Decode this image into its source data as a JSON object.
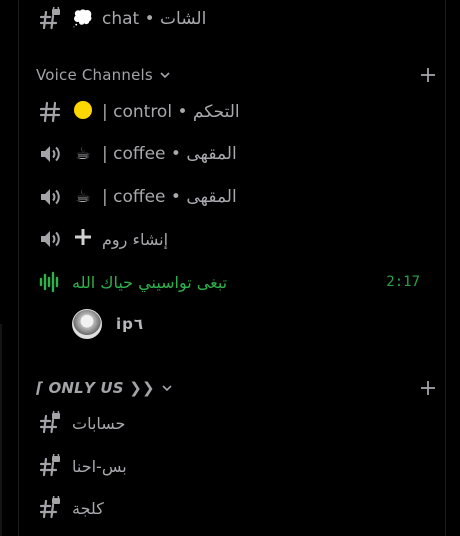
{
  "channels_top": [
    {
      "name": "chat • الشات",
      "emoji": "💭",
      "icon": "hash-locked-icon"
    }
  ],
  "categories": [
    {
      "name": "Voice Channels",
      "add_icon": "plus-icon"
    },
    {
      "name": "⌈ 𝙊𝙉𝙇𝙔 𝙐𝙎 ❯❯",
      "add_icon": "plus-icon"
    }
  ],
  "voice_section": [
    {
      "name": "| control • التحكم",
      "emoji": "🟡",
      "icon": "hash-icon"
    },
    {
      "name": "| coffee • المقهى",
      "emoji": "☕",
      "icon": "speaker-icon"
    },
    {
      "name": "| coffee • المقهى",
      "emoji": "☕",
      "icon": "speaker-icon"
    },
    {
      "name": "إنشاء روم",
      "emoji": "➕",
      "icon": "speaker-icon"
    },
    {
      "name": "تبغى تواسيني حياك الله",
      "icon": "voice-active-icon",
      "time": "2:17"
    }
  ],
  "voice_user": {
    "name": "ip٦",
    "icon": "avatar"
  },
  "only_us_channels": [
    {
      "name": "حسابات",
      "icon": "hash-locked-icon"
    },
    {
      "name": "بس-احنا",
      "icon": "hash-locked-icon"
    },
    {
      "name": "كلجة",
      "icon": "hash-locked-icon"
    }
  ],
  "colors": {
    "active_green": "#2fb04c",
    "text": "#a8a8ad",
    "background": "#000000"
  }
}
